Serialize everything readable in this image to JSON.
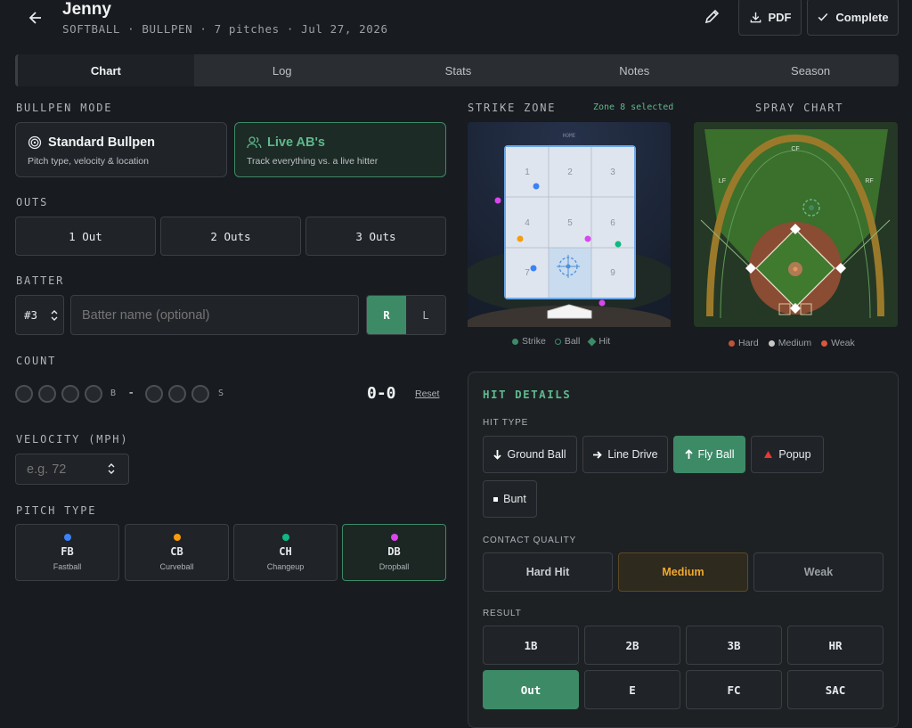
{
  "header": {
    "back_icon": "arrow-left-icon",
    "title": "Jenny",
    "subtitle": "SOFTBALL · BULLPEN · 7 pitches · Jul 27, 2026",
    "pdf_label": "PDF",
    "complete_label": "Complete"
  },
  "tabs": [
    {
      "label": "Chart",
      "active": true
    },
    {
      "label": "Log"
    },
    {
      "label": "Stats"
    },
    {
      "label": "Notes"
    },
    {
      "label": "Season"
    }
  ],
  "bullpen_mode": {
    "label": "BULLPEN MODE",
    "standard": {
      "title": "Standard Bullpen",
      "desc": "Pitch type, velocity & location",
      "selected": false
    },
    "live": {
      "title": "Live AB's",
      "desc": "Track everything vs. a live hitter",
      "selected": true
    }
  },
  "outs": {
    "label": "OUTS",
    "options": [
      "1 Out",
      "2 Outs",
      "3 Outs"
    ]
  },
  "batter": {
    "label": "BATTER",
    "number": "#3",
    "name_placeholder": "Batter name (optional)",
    "hand_r": "R",
    "hand_l": "L",
    "selected_hand": "R"
  },
  "count": {
    "label": "COUNT",
    "balls_label": "B",
    "strikes_label": "S",
    "separator": "-",
    "value": "0-0",
    "reset": "Reset",
    "balls": 0,
    "strikes": 0
  },
  "velocity": {
    "label": "VELOCITY (MPH)",
    "placeholder": "e.g. 72"
  },
  "pitch_type": {
    "label": "PITCH TYPE",
    "options": [
      {
        "abbr": "FB",
        "name": "Fastball",
        "color": "#3b82f6"
      },
      {
        "abbr": "CB",
        "name": "Curveball",
        "color": "#f59e0b"
      },
      {
        "abbr": "CH",
        "name": "Changeup",
        "color": "#10b981"
      },
      {
        "abbr": "DB",
        "name": "Dropball",
        "color": "#d946ef",
        "selected": true
      }
    ]
  },
  "strike_zone": {
    "label": "STRIKE ZONE",
    "status": "Zone 8 selected",
    "plate_text": "HOME",
    "zones": [
      "1",
      "2",
      "3",
      "4",
      "5",
      "6",
      "7",
      "8",
      "9"
    ],
    "selected_zone": "8",
    "legend": [
      "Strike",
      "Ball",
      "Hit"
    ]
  },
  "spray_chart": {
    "label": "SPRAY CHART",
    "field_labels": {
      "lf": "LF",
      "cf": "CF",
      "rf": "RF"
    },
    "legend": [
      {
        "label": "Hard",
        "color": "#c0543a"
      },
      {
        "label": "Medium",
        "color": "#c8c8c8"
      },
      {
        "label": "Weak",
        "color": "#d9573a"
      }
    ]
  },
  "hit_details": {
    "title": "HIT DETAILS",
    "hit_type_label": "HIT TYPE",
    "hit_types": [
      {
        "label": "Ground Ball",
        "icon": "arrow-down-icon"
      },
      {
        "label": "Line Drive",
        "icon": "arrow-right-icon"
      },
      {
        "label": "Fly Ball",
        "icon": "arrow-up-icon",
        "selected": true
      },
      {
        "label": "Popup",
        "icon": "triangle-icon"
      },
      {
        "label": "Bunt",
        "icon": "square-icon"
      }
    ],
    "contact_label": "CONTACT QUALITY",
    "contact": [
      "Hard Hit",
      "Medium",
      "Weak"
    ],
    "contact_selected": "Medium",
    "result_label": "RESULT",
    "results": [
      "1B",
      "2B",
      "3B",
      "HR",
      "Out",
      "E",
      "FC",
      "SAC"
    ],
    "result_selected": "Out"
  }
}
